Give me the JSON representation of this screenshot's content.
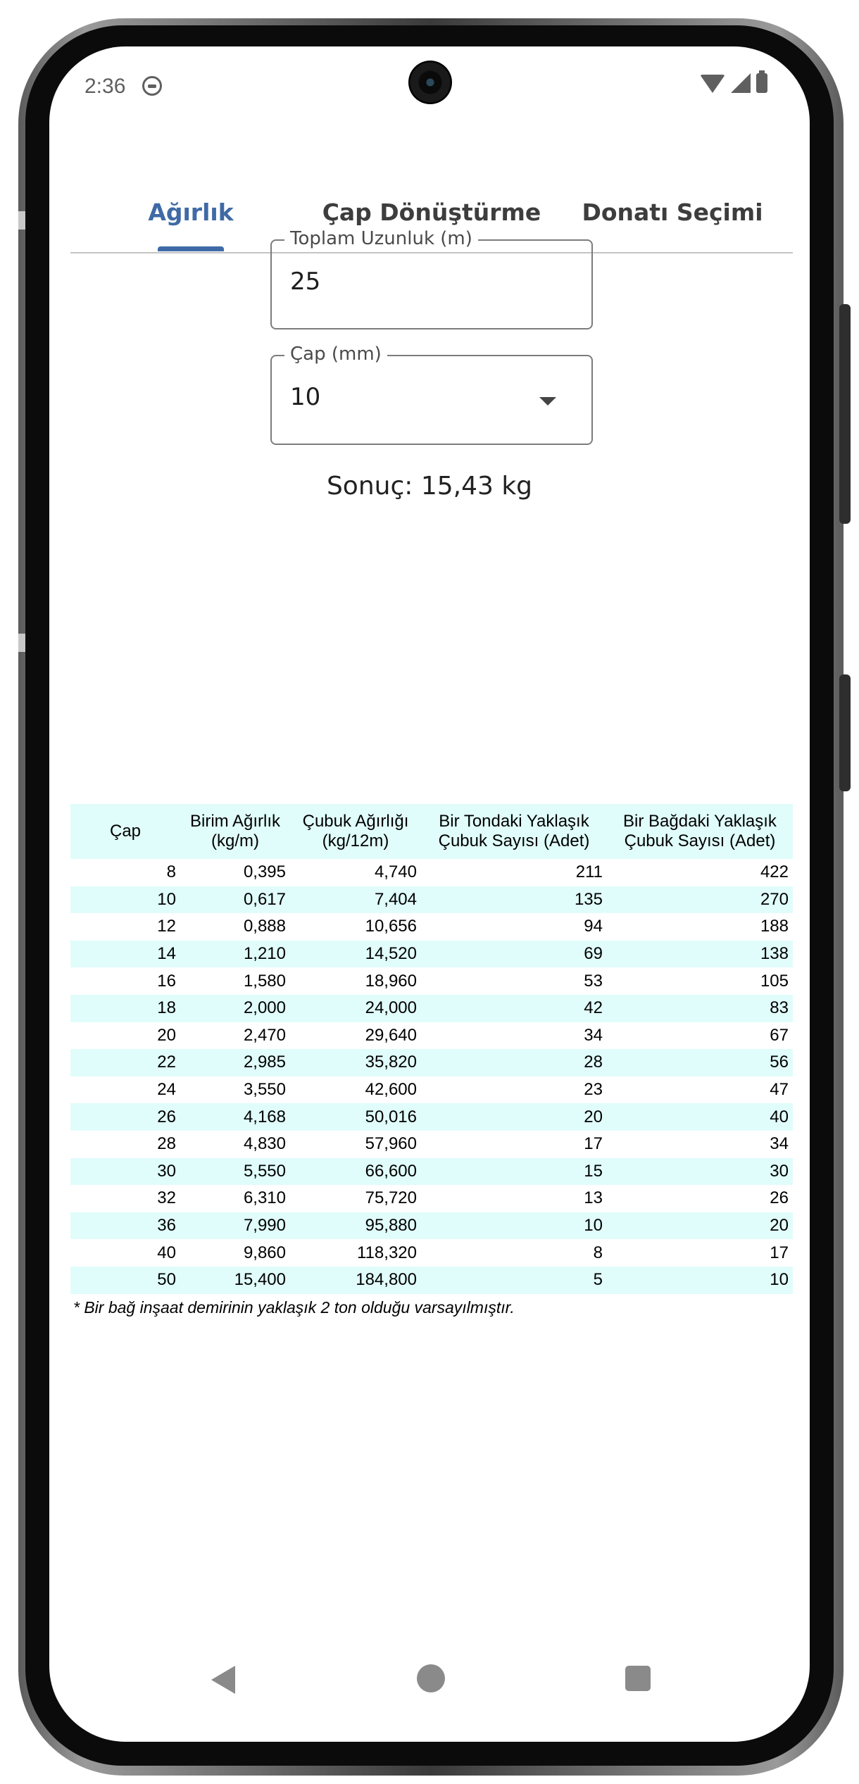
{
  "status_bar": {
    "time": "2:36"
  },
  "tabs": [
    {
      "label": "Ağırlık",
      "active": true
    },
    {
      "label": "Çap Dönüştürme",
      "active": false
    },
    {
      "label": "Donatı Seçimi",
      "active": false
    }
  ],
  "form": {
    "length": {
      "label": "Toplam Uzunluk (m)",
      "value": "25"
    },
    "diameter": {
      "label": "Çap (mm)",
      "value": "10"
    }
  },
  "result_text": "Sonuç: 15,43 kg",
  "table": {
    "headers": [
      [
        "Çap",
        ""
      ],
      [
        "Birim Ağırlık",
        "(kg/m)"
      ],
      [
        "Çubuk Ağırlığı",
        "(kg/12m)"
      ],
      [
        "Bir Tondaki Yaklaşık",
        "Çubuk Sayısı (Adet)"
      ],
      [
        "Bir Bağdaki Yaklaşık",
        "Çubuk Sayısı (Adet)"
      ]
    ],
    "rows": [
      [
        "8",
        "0,395",
        "4,740",
        "211",
        "422"
      ],
      [
        "10",
        "0,617",
        "7,404",
        "135",
        "270"
      ],
      [
        "12",
        "0,888",
        "10,656",
        "94",
        "188"
      ],
      [
        "14",
        "1,210",
        "14,520",
        "69",
        "138"
      ],
      [
        "16",
        "1,580",
        "18,960",
        "53",
        "105"
      ],
      [
        "18",
        "2,000",
        "24,000",
        "42",
        "83"
      ],
      [
        "20",
        "2,470",
        "29,640",
        "34",
        "67"
      ],
      [
        "22",
        "2,985",
        "35,820",
        "28",
        "56"
      ],
      [
        "24",
        "3,550",
        "42,600",
        "23",
        "47"
      ],
      [
        "26",
        "4,168",
        "50,016",
        "20",
        "40"
      ],
      [
        "28",
        "4,830",
        "57,960",
        "17",
        "34"
      ],
      [
        "30",
        "5,550",
        "66,600",
        "15",
        "30"
      ],
      [
        "32",
        "6,310",
        "75,720",
        "13",
        "26"
      ],
      [
        "36",
        "7,990",
        "95,880",
        "10",
        "20"
      ],
      [
        "40",
        "9,860",
        "118,320",
        "8",
        "17"
      ],
      [
        "50",
        "15,400",
        "184,800",
        "5",
        "10"
      ]
    ],
    "note": "* Bir bağ inşaat demirinin yaklaşık 2 ton olduğu varsayılmıştır."
  },
  "colors": {
    "accent": "#3f6aa6",
    "table_stripe": "#e0fdfb"
  },
  "icons": {
    "status": [
      "notification-face-icon",
      "wifi-icon",
      "signal-icon",
      "battery-icon"
    ],
    "nav": [
      "back-icon",
      "home-icon",
      "recents-icon"
    ],
    "dropdown": "dropdown-arrow-icon"
  }
}
